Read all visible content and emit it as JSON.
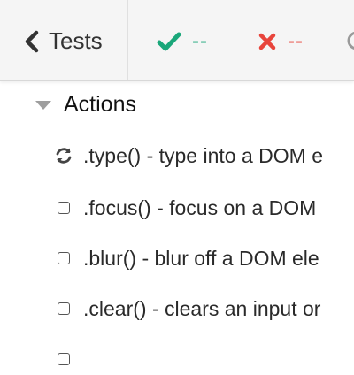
{
  "header": {
    "back_label": "Tests",
    "passed_count": "--",
    "failed_count": "--"
  },
  "colors": {
    "pass": "#1aa77a",
    "fail": "#e8453c",
    "header_bg": "#f5f5f5"
  },
  "suite": {
    "title": "Actions"
  },
  "tests": [
    {
      "icon": "refresh-icon",
      "label": ".type() - type into a DOM e"
    },
    {
      "icon": "checkbox-icon",
      "label": ".focus() - focus on a DOM"
    },
    {
      "icon": "checkbox-icon",
      "label": ".blur() - blur off a DOM ele"
    },
    {
      "icon": "checkbox-icon",
      "label": ".clear() - clears an input or"
    }
  ]
}
